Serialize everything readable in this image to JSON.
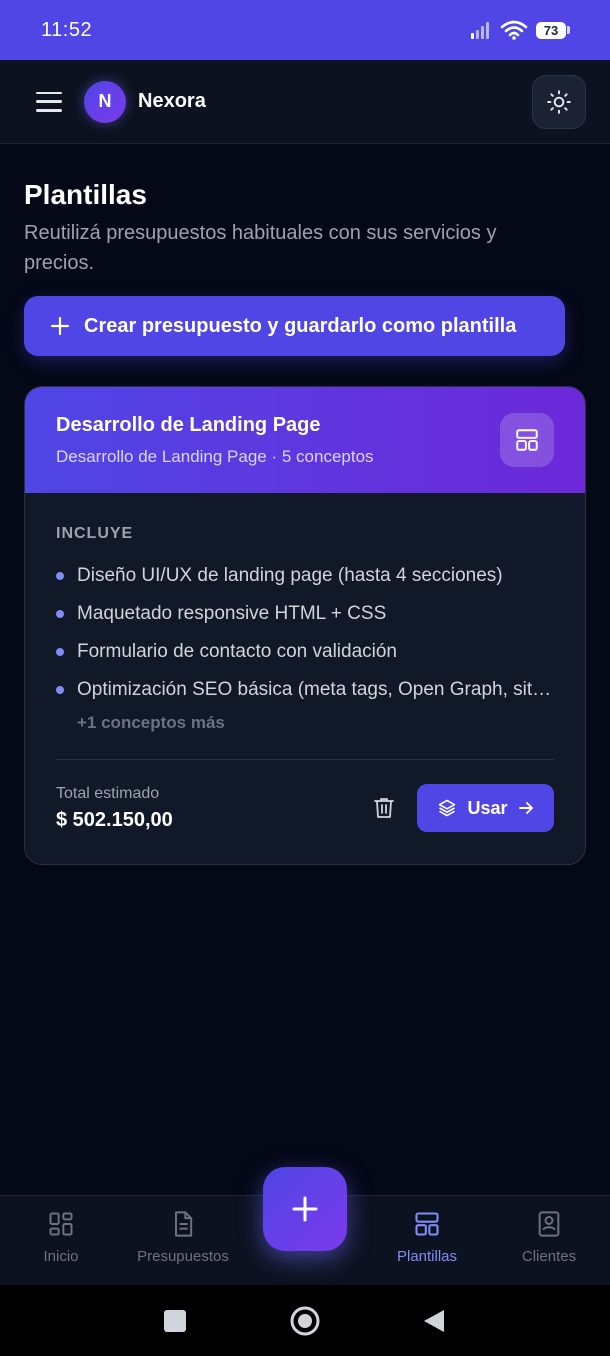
{
  "status_bar": {
    "time": "11:52",
    "battery": "73"
  },
  "header": {
    "logo_letter": "N",
    "brand": "Nexora"
  },
  "page": {
    "title": "Plantillas",
    "subtitle": "Reutilizá presupuestos habituales con sus servicios y precios.",
    "create_button": "Crear presupuesto y guardarlo como plantilla"
  },
  "template_card": {
    "title": "Desarrollo de Landing Page",
    "subtitle": "Desarrollo de Landing Page · 5 conceptos",
    "includes_label": "INCLUYE",
    "concepts": [
      "Diseño UI/UX de landing page (hasta 4 secciones)",
      "Maquetado responsive HTML + CSS",
      "Formulario de contacto con validación",
      "Optimización SEO básica (meta tags, Open Graph, sitemap)"
    ],
    "more": "+1 conceptos más",
    "total_label": "Total estimado",
    "total_value": "$ 502.150,00",
    "use_button": "Usar"
  },
  "bottom_nav": {
    "items": [
      {
        "label": "Inicio",
        "icon": "grid-icon"
      },
      {
        "label": "Presupuestos",
        "icon": "document-icon"
      },
      {
        "label": "Plantillas",
        "icon": "layout-icon",
        "active": true
      },
      {
        "label": "Clientes",
        "icon": "contact-book-icon"
      }
    ]
  },
  "colors": {
    "accent": "#4f46e5",
    "accent_alt": "#7c3aed",
    "background": "#050816"
  }
}
